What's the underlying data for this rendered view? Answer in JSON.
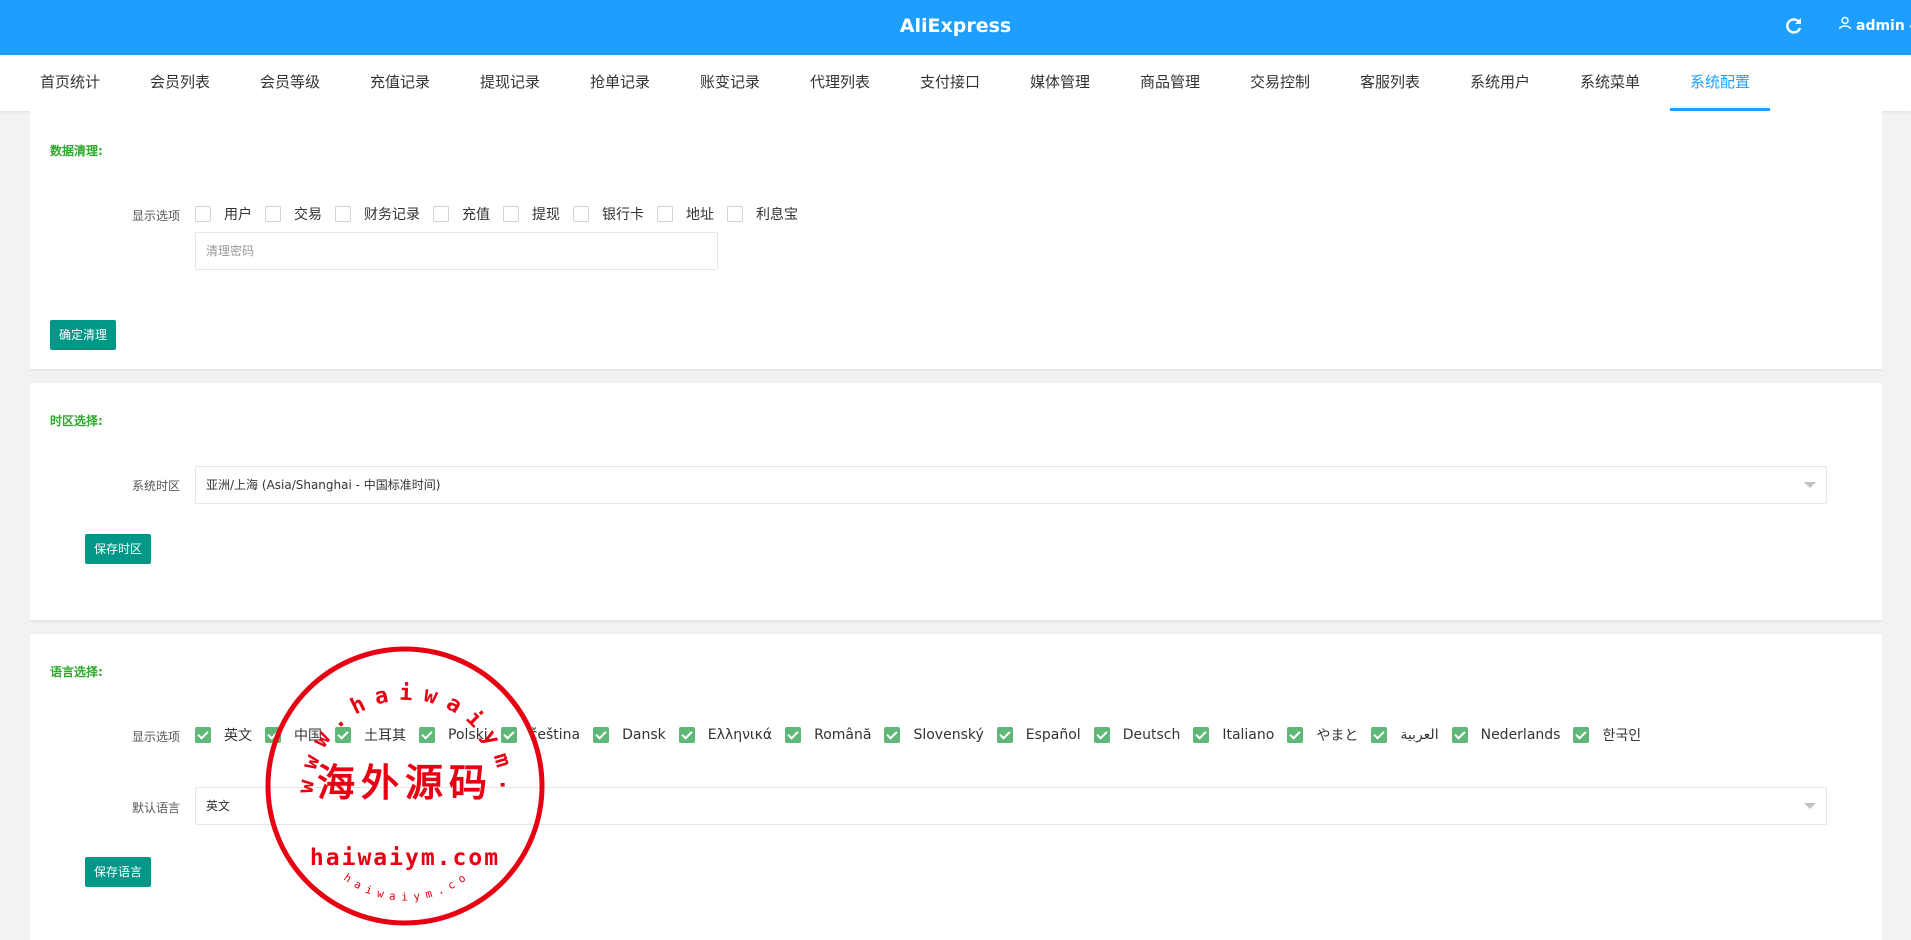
{
  "header": {
    "title": "AliExpress",
    "user": "admin",
    "refresh_icon": "refresh-icon",
    "user_icon": "user-icon",
    "color": "#1e9fff"
  },
  "nav": {
    "tabs": [
      {
        "label": "首页统计"
      },
      {
        "label": "会员列表"
      },
      {
        "label": "会员等级"
      },
      {
        "label": "充值记录"
      },
      {
        "label": "提现记录"
      },
      {
        "label": "抢单记录"
      },
      {
        "label": "账变记录"
      },
      {
        "label": "代理列表"
      },
      {
        "label": "支付接口"
      },
      {
        "label": "媒体管理"
      },
      {
        "label": "商品管理"
      },
      {
        "label": "交易控制"
      },
      {
        "label": "客服列表"
      },
      {
        "label": "系统用户"
      },
      {
        "label": "系统菜单"
      },
      {
        "label": "系统配置",
        "active": true
      }
    ]
  },
  "data_clear": {
    "title": "数据清理:",
    "options_label": "显示选项",
    "options": [
      {
        "label": "用户",
        "checked": false
      },
      {
        "label": "交易",
        "checked": false
      },
      {
        "label": "财务记录",
        "checked": false
      },
      {
        "label": "充值",
        "checked": false
      },
      {
        "label": "提现",
        "checked": false
      },
      {
        "label": "银行卡",
        "checked": false
      },
      {
        "label": "地址",
        "checked": false
      },
      {
        "label": "利息宝",
        "checked": false
      }
    ],
    "password_placeholder": "清理密码",
    "confirm_button": "确定清理"
  },
  "timezone": {
    "title": "时区选择:",
    "label": "系统时区",
    "value": "亚洲/上海 (Asia/Shanghai - 中国标准时间)",
    "save_button": "保存时区"
  },
  "language": {
    "title": "语言选择:",
    "options_label": "显示选项",
    "options": [
      {
        "label": "英文",
        "checked": true
      },
      {
        "label": "中国",
        "checked": true
      },
      {
        "label": "土耳其",
        "checked": true
      },
      {
        "label": "Polski",
        "checked": true
      },
      {
        "label": "čeština",
        "checked": true
      },
      {
        "label": "Dansk",
        "checked": true
      },
      {
        "label": "Ελληνικά",
        "checked": true
      },
      {
        "label": "Română",
        "checked": true
      },
      {
        "label": "Slovenský",
        "checked": true
      },
      {
        "label": "Español",
        "checked": true
      },
      {
        "label": "Deutsch",
        "checked": true
      },
      {
        "label": "Italiano",
        "checked": true
      },
      {
        "label": "やまと",
        "checked": true
      },
      {
        "label": "العربية",
        "checked": true
      },
      {
        "label": "Nederlands",
        "checked": true
      },
      {
        "label": "한국인",
        "checked": true
      }
    ],
    "default_label": "默认语言",
    "default_value": "英文",
    "save_button": "保存语言"
  },
  "watermark": {
    "center_text": "海外源码",
    "ring_text": "www.haiwaiym.com",
    "bottom_text": "haiwaiym.com",
    "small_text": "haiwaiym.com",
    "color": "#e60012"
  }
}
